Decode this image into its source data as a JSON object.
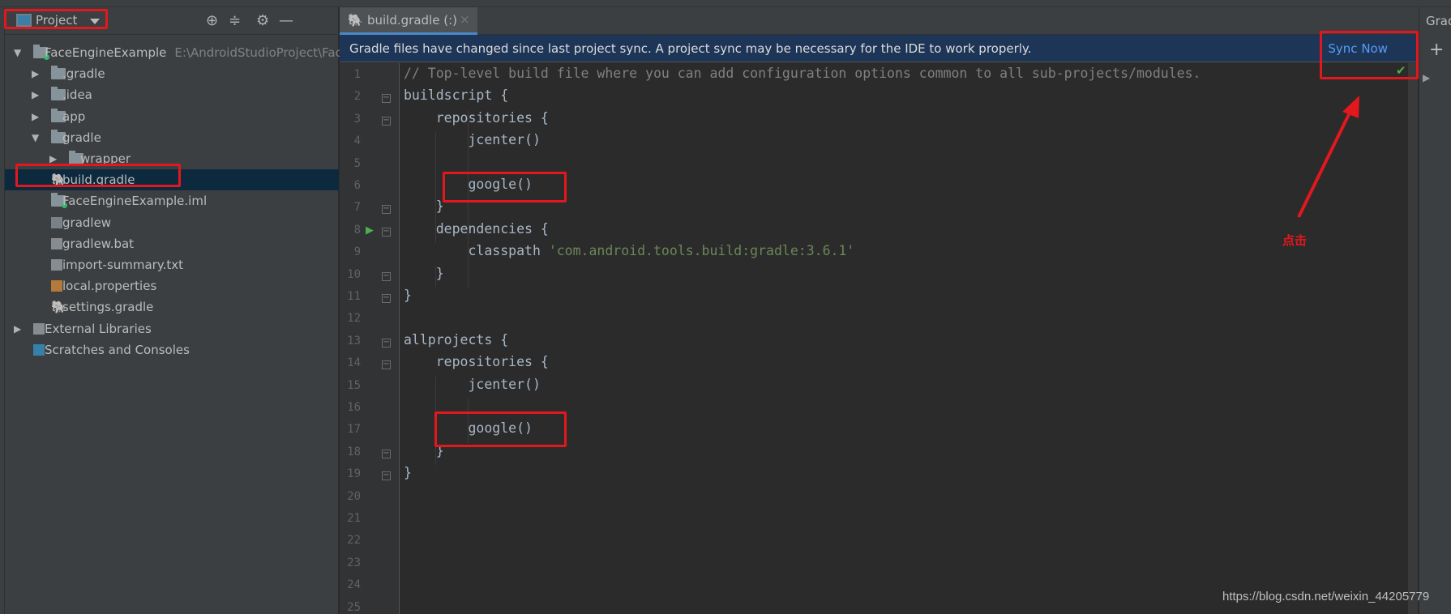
{
  "sidebar": {
    "title": "Project",
    "icons": [
      "locate-icon",
      "collapse-all-icon",
      "gear-icon",
      "minimize-icon"
    ],
    "tree": [
      {
        "label": "FaceEngineExample",
        "path": "E:\\AndroidStudioProject\\Fac",
        "level": 0,
        "arrow": "down",
        "icon": "module"
      },
      {
        "label": ".gradle",
        "level": 1,
        "arrow": "right",
        "icon": "folder"
      },
      {
        "label": ".idea",
        "level": 1,
        "arrow": "right",
        "icon": "folder"
      },
      {
        "label": "app",
        "level": 1,
        "arrow": "right",
        "icon": "folder"
      },
      {
        "label": "gradle",
        "level": 1,
        "arrow": "down",
        "icon": "folder"
      },
      {
        "label": "wrapper",
        "level": 2,
        "arrow": "right",
        "icon": "folder"
      },
      {
        "label": "build.gradle",
        "level": 1,
        "icon": "gradle",
        "selected": true
      },
      {
        "label": "FaceEngineExample.iml",
        "level": 1,
        "icon": "module"
      },
      {
        "label": "gradlew",
        "level": 1,
        "icon": "script"
      },
      {
        "label": "gradlew.bat",
        "level": 1,
        "icon": "text"
      },
      {
        "label": "import-summary.txt",
        "level": 1,
        "icon": "text"
      },
      {
        "label": "local.properties",
        "level": 1,
        "icon": "properties"
      },
      {
        "label": "settings.gradle",
        "level": 1,
        "icon": "gradle"
      },
      {
        "label": "External Libraries",
        "level": 0,
        "arrow": "right",
        "icon": "libraries"
      },
      {
        "label": "Scratches and Consoles",
        "level": 0,
        "icon": "scratches"
      }
    ]
  },
  "tab": {
    "label": "build.gradle (:)",
    "close": "×"
  },
  "banner": {
    "message": "Gradle files have changed since last project sync. A project sync may be necessary for the IDE to work properly.",
    "action": "Sync Now"
  },
  "editor": {
    "lines": [
      "// Top-level build file where you can add configuration options common to all sub-projects/modules.",
      "buildscript {",
      "    repositories {",
      "        jcenter()",
      "",
      "        google()",
      "    }",
      "    dependencies {",
      "        classpath 'com.android.tools.build:gradle:3.6.1'",
      "    }",
      "}",
      "",
      "allprojects {",
      "    repositories {",
      "        jcenter()",
      "",
      "        google()",
      "    }",
      "}",
      "",
      "",
      "",
      "",
      "",
      ""
    ],
    "fold_lines": [
      2,
      3,
      7,
      8,
      10,
      11,
      13,
      14,
      18,
      19
    ],
    "run_line": 8
  },
  "right_panel": {
    "title": "Gradle",
    "add": "+"
  },
  "annotation": {
    "text": "点击",
    "color": "#e3171e"
  },
  "watermark": "https://blog.csdn.net/weixin_44205779"
}
